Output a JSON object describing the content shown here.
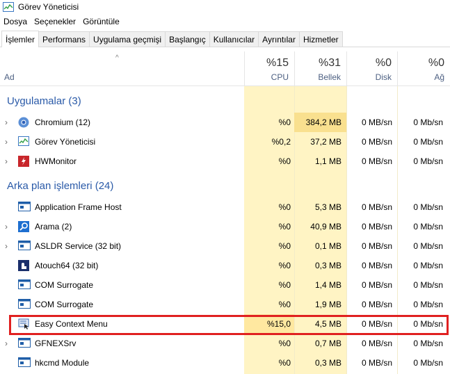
{
  "window": {
    "title": "Görev Yöneticisi"
  },
  "menu": [
    "Dosya",
    "Seçenekler",
    "Görüntüle"
  ],
  "tabs": [
    "İşlemler",
    "Performans",
    "Uygulama geçmişi",
    "Başlangıç",
    "Kullanıcılar",
    "Ayrıntılar",
    "Hizmetler"
  ],
  "header": {
    "name_label": "Ad",
    "sort_arrow": "^",
    "cpu": {
      "pct": "%15",
      "label": "CPU"
    },
    "memory": {
      "pct": "%31",
      "label": "Bellek"
    },
    "disk": {
      "pct": "%0",
      "label": "Disk"
    },
    "network": {
      "pct": "%0",
      "label": "Ağ"
    }
  },
  "groups": {
    "apps": "Uygulamalar (3)",
    "background": "Arka plan işlemleri (24)"
  },
  "rows": [
    {
      "name": "Chromium (12)",
      "cpu": "%0",
      "mem": "384,2 MB",
      "disk": "0 MB/sn",
      "net": "0 Mb/sn",
      "icon": "chromium-icon",
      "expandable": true
    },
    {
      "name": "Görev Yöneticisi",
      "cpu": "%0,2",
      "mem": "37,2 MB",
      "disk": "0 MB/sn",
      "net": "0 Mb/sn",
      "icon": "task-manager-icon",
      "expandable": true
    },
    {
      "name": "HWMonitor",
      "cpu": "%0",
      "mem": "1,1 MB",
      "disk": "0 MB/sn",
      "net": "0 Mb/sn",
      "icon": "hwmonitor-icon",
      "expandable": true
    },
    {
      "name": "Application Frame Host",
      "cpu": "%0",
      "mem": "5,3 MB",
      "disk": "0 MB/sn",
      "net": "0 Mb/sn",
      "icon": "window-icon",
      "expandable": false
    },
    {
      "name": "Arama (2)",
      "cpu": "%0",
      "mem": "40,9 MB",
      "disk": "0 MB/sn",
      "net": "0 Mb/sn",
      "icon": "search-icon",
      "expandable": true
    },
    {
      "name": "ASLDR Service (32 bit)",
      "cpu": "%0",
      "mem": "0,1 MB",
      "disk": "0 MB/sn",
      "net": "0 Mb/sn",
      "icon": "window-icon",
      "expandable": true
    },
    {
      "name": "Atouch64 (32 bit)",
      "cpu": "%0",
      "mem": "0,3 MB",
      "disk": "0 MB/sn",
      "net": "0 Mb/sn",
      "icon": "atouch-icon",
      "expandable": false
    },
    {
      "name": "COM Surrogate",
      "cpu": "%0",
      "mem": "1,4 MB",
      "disk": "0 MB/sn",
      "net": "0 Mb/sn",
      "icon": "window-icon",
      "expandable": false
    },
    {
      "name": "COM Surrogate",
      "cpu": "%0",
      "mem": "1,9 MB",
      "disk": "0 MB/sn",
      "net": "0 Mb/sn",
      "icon": "window-icon",
      "expandable": false
    },
    {
      "name": "Easy Context Menu",
      "cpu": "%15,0",
      "mem": "4,5 MB",
      "disk": "0 MB/sn",
      "net": "0 Mb/sn",
      "icon": "context-menu-icon",
      "expandable": false
    },
    {
      "name": "GFNEXSrv",
      "cpu": "%0",
      "mem": "0,7 MB",
      "disk": "0 MB/sn",
      "net": "0 Mb/sn",
      "icon": "window-icon",
      "expandable": true
    },
    {
      "name": "hkcmd Module",
      "cpu": "%0",
      "mem": "0,3 MB",
      "disk": "0 MB/sn",
      "net": "0 Mb/sn",
      "icon": "window-icon",
      "expandable": false
    }
  ],
  "colors": {
    "accent": "#2a5aa8",
    "cpu_bg": "#fff4c4",
    "mem_highlight": "#f9e08f",
    "selection_box": "#e02020"
  }
}
